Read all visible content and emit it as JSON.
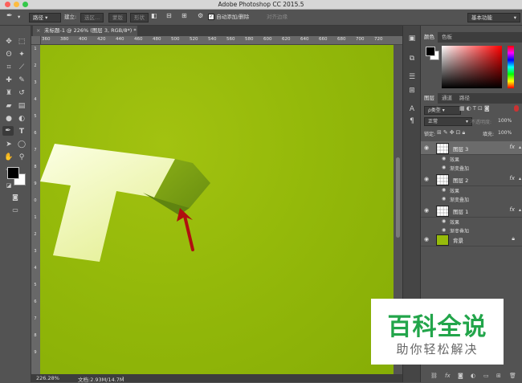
{
  "window": {
    "title": "Adobe Photoshop CC 2015.5"
  },
  "options_bar": {
    "path_mode": "路径",
    "make_label": "建立:",
    "selection_btn": "选区...",
    "mask_btn": "蒙版",
    "shape_btn": "形状",
    "auto_add_delete": "自动添加/删除",
    "align_edges": "对齐边缘",
    "workspace": "基本功能"
  },
  "document": {
    "tab_title": "未标题-1 @ 226% (图层 3, RGB/8*) *",
    "ruler_top": [
      "360",
      "380",
      "400",
      "420",
      "440",
      "460",
      "480",
      "500",
      "520",
      "540",
      "560",
      "580",
      "600",
      "620",
      "640",
      "660",
      "680",
      "700",
      "720"
    ],
    "ruler_left": [
      "1",
      "2",
      "3",
      "4",
      "5",
      "6",
      "7",
      "8",
      "9",
      "0",
      "1",
      "2",
      "3",
      "4",
      "5",
      "6",
      "7",
      "8",
      "9"
    ],
    "zoom": "226.28%",
    "doc_info": "文档:2.93M/14.7M"
  },
  "color_panel": {
    "tab_color": "颜色",
    "tab_swatches": "色板"
  },
  "layers_panel": {
    "tab_layers": "图层",
    "tab_channels": "通道",
    "tab_paths": "路径",
    "filter_kind": "ρ类型",
    "blend_mode": "正常",
    "opacity_label": "不透明度:",
    "opacity_value": "100%",
    "lock_label": "锁定:",
    "fill_label": "填充:",
    "fill_value": "100%",
    "layers": [
      {
        "name": "图层 3",
        "effects": "效果",
        "effect": "渐变叠加"
      },
      {
        "name": "图层 2",
        "effects": "效果",
        "effect": "渐变叠加"
      },
      {
        "name": "图层 1",
        "effects": "效果",
        "effect": "渐变叠加"
      },
      {
        "name": "背景"
      }
    ],
    "fx": "fx"
  },
  "watermark": {
    "main": "百科全说",
    "sub": "助你轻松解决"
  },
  "colors": {
    "canvas": "#97bc0b",
    "arrow": "#b01010",
    "watermark_green": "#22a54a"
  }
}
